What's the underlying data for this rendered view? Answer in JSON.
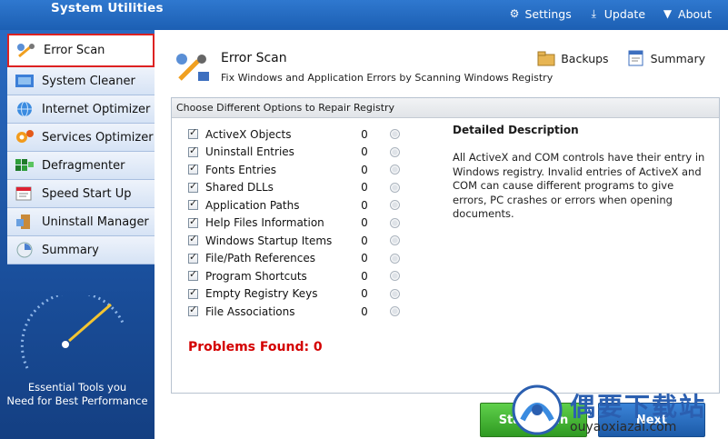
{
  "app": {
    "title": "System Utilities"
  },
  "top_nav": [
    {
      "label": "Settings",
      "icon": "gear-icon"
    },
    {
      "label": "Update",
      "icon": "download-icon"
    },
    {
      "label": "About",
      "icon": "chevron-down-icon"
    }
  ],
  "sidebar": {
    "items": [
      {
        "label": "Error Scan",
        "icon": "wrench-icon",
        "active": true
      },
      {
        "label": "System Cleaner",
        "icon": "cleaner-icon"
      },
      {
        "label": "Internet Optimizer",
        "icon": "globe-icon"
      },
      {
        "label": "Services Optimizer",
        "icon": "services-icon"
      },
      {
        "label": "Defragmenter",
        "icon": "defrag-icon"
      },
      {
        "label": "Speed Start Up",
        "icon": "startup-icon"
      },
      {
        "label": "Uninstall Manager",
        "icon": "uninstall-icon"
      },
      {
        "label": "Summary",
        "icon": "summary-icon"
      }
    ],
    "tagline_line1": "Essential Tools you",
    "tagline_line2": "Need for Best Performance"
  },
  "main": {
    "title": "Error Scan",
    "subtitle": "Fix Windows and Application Errors by Scanning Windows Registry",
    "actions": [
      {
        "label": "Backups",
        "icon": "backup-icon"
      },
      {
        "label": "Summary",
        "icon": "summary-doc-icon"
      }
    ],
    "panel_header": "Choose Different Options to Repair Registry",
    "options": [
      {
        "label": "ActiveX Objects",
        "count": "0",
        "checked": true
      },
      {
        "label": "Uninstall Entries",
        "count": "0",
        "checked": true
      },
      {
        "label": "Fonts Entries",
        "count": "0",
        "checked": true
      },
      {
        "label": "Shared DLLs",
        "count": "0",
        "checked": true
      },
      {
        "label": "Application Paths",
        "count": "0",
        "checked": true
      },
      {
        "label": "Help Files Information",
        "count": "0",
        "checked": true
      },
      {
        "label": "Windows Startup Items",
        "count": "0",
        "checked": true
      },
      {
        "label": "File/Path References",
        "count": "0",
        "checked": true
      },
      {
        "label": "Program Shortcuts",
        "count": "0",
        "checked": true
      },
      {
        "label": "Empty Registry Keys",
        "count": "0",
        "checked": true
      },
      {
        "label": "File Associations",
        "count": "0",
        "checked": true
      }
    ],
    "description": {
      "title": "Detailed Description",
      "text": "All ActiveX and COM controls have their entry in Windows registry. Invalid entries of ActiveX and COM can cause different programs to give errors, PC crashes or errors when opening documents."
    },
    "problems_found": "Problems Found: 0",
    "buttons": {
      "start_scan": "Start Scan",
      "next": "Next"
    }
  },
  "watermark": {
    "line1": "偶要下载站",
    "line2": "ouyaoxiazai.com"
  },
  "colors": {
    "header": "#1c5fb3",
    "problems": "#d40000",
    "start": "#2f9a22",
    "next": "#1c5aa8"
  }
}
